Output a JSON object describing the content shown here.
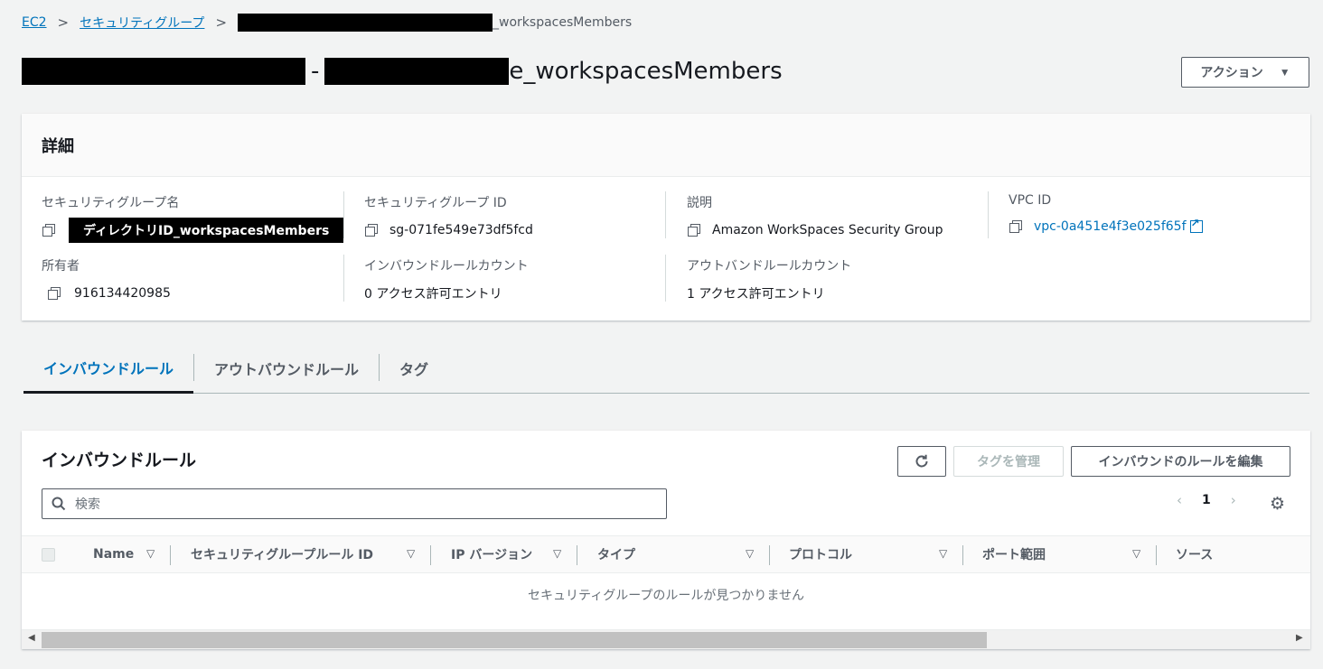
{
  "breadcrumb": {
    "root": "EC2",
    "section": "セキュリティグループ",
    "current_suffix": "_workspacesMembers"
  },
  "page": {
    "title_sep": "-",
    "title_suffix": "e_workspacesMembers",
    "actions_label": "アクション",
    "actions_caret": "▼"
  },
  "details": {
    "heading": "詳細",
    "fields": {
      "sg_name_label": "セキュリティグループ名",
      "sg_name_value": "ディレクトリID_workspacesMembers",
      "sg_id_label": "セキュリティグループ ID",
      "sg_id_value": "sg-071fe549e73df5fcd",
      "description_label": "説明",
      "description_value": "Amazon WorkSpaces Security Group",
      "vpc_id_label": "VPC ID",
      "vpc_id_value": "vpc-0a451e4f3e025f65f",
      "owner_label": "所有者",
      "owner_value": "916134420985",
      "inbound_count_label": "インバウンドルールカウント",
      "inbound_count_value": "0 アクセス許可エントリ",
      "outbound_count_label": "アウトバンドルールカウント",
      "outbound_count_value": "1 アクセス許可エントリ"
    }
  },
  "tabs": [
    {
      "label": "インバウンドルール",
      "active": true
    },
    {
      "label": "アウトバウンドルール",
      "active": false
    },
    {
      "label": "タグ",
      "active": false
    }
  ],
  "rules_panel": {
    "title": "インバウンドルール",
    "refresh_icon": "refresh-icon",
    "manage_tags_label": "タグを管理",
    "edit_rules_label": "インバウンドのルールを編集",
    "search_placeholder": "検索",
    "page_number": "1",
    "columns": [
      "Name",
      "セキュリティグループルール ID",
      "IP バージョン",
      "タイプ",
      "プロトコル",
      "ポート範囲",
      "ソース"
    ],
    "empty_message": "セキュリティグループのルールが見つかりません"
  },
  "colors": {
    "link": "#0073bb",
    "text": "#16191f",
    "muted": "#545b64"
  }
}
